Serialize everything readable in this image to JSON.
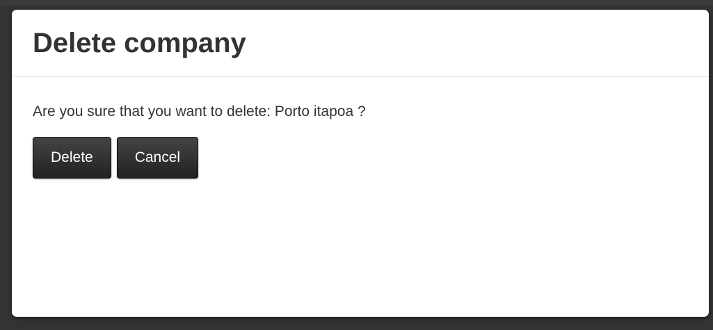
{
  "modal": {
    "title": "Delete company",
    "message": "Are you sure that you want to delete: Porto itapoa ?",
    "buttons": {
      "delete_label": "Delete",
      "cancel_label": "Cancel"
    }
  },
  "colors": {
    "backdrop": "#333333",
    "modal_background": "#ffffff",
    "button_background": "#2f2f2f",
    "button_text": "#ffffff",
    "text": "#333333"
  }
}
